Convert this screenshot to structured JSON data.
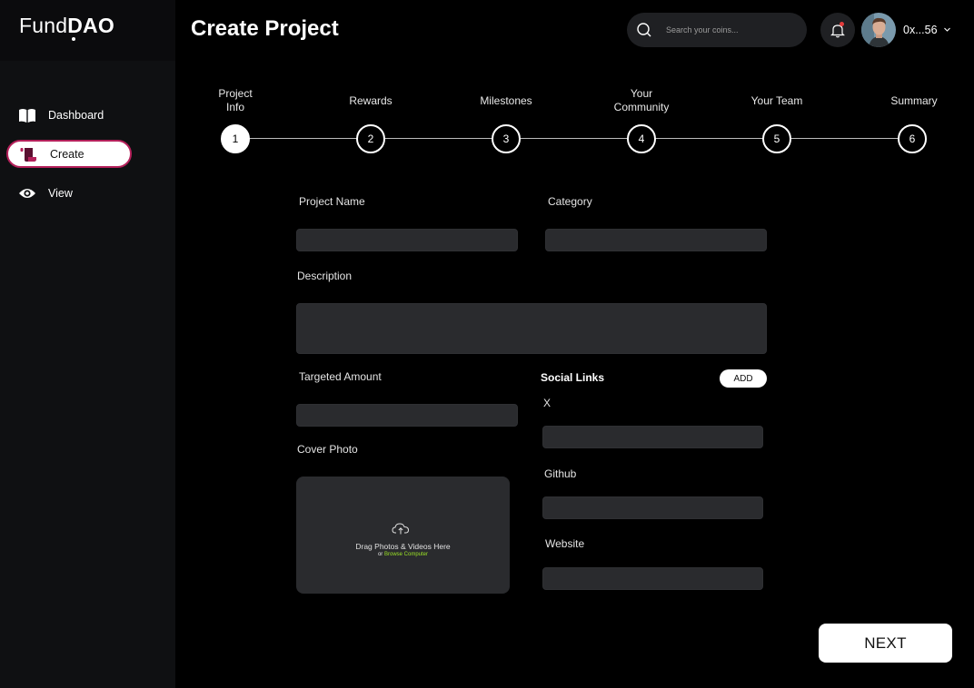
{
  "app": {
    "brand_light": "Fund",
    "brand_bold": "DAO",
    "accent_color": "#b4205a",
    "link_color": "#9be326"
  },
  "sidebar": {
    "items": [
      {
        "label": "Dashboard",
        "icon": "book-icon",
        "active": false
      },
      {
        "label": "Create",
        "icon": "scroll-icon",
        "active": true
      },
      {
        "label": "View",
        "icon": "eye-icon",
        "active": false
      }
    ]
  },
  "header": {
    "title": "Create Project",
    "search_placeholder": "Search your coins...",
    "account": "0x...56"
  },
  "stepper": {
    "current": 1,
    "steps": [
      {
        "number": "1",
        "label_lines": [
          "Project",
          "Info"
        ]
      },
      {
        "number": "2",
        "label_lines": [
          "Rewards"
        ]
      },
      {
        "number": "3",
        "label_lines": [
          "Milestones"
        ]
      },
      {
        "number": "4",
        "label_lines": [
          "Your",
          "Community"
        ]
      },
      {
        "number": "5",
        "label_lines": [
          "Your Team"
        ]
      },
      {
        "number": "6",
        "label_lines": [
          "Summary"
        ]
      }
    ]
  },
  "form": {
    "project_name_label": "Project Name",
    "project_name_value": "",
    "category_label": "Category",
    "category_value": "",
    "description_label": "Description",
    "description_value": "",
    "targeted_amount_label": "Targeted Amount",
    "targeted_amount_value": "",
    "cover_photo_label": "Cover Photo",
    "drop_main": "Drag Photos & Videos Here",
    "drop_or": "or ",
    "drop_link": "Browse Computer"
  },
  "social": {
    "title": "Social Links",
    "add_label": "ADD",
    "x_label": "X",
    "x_value": "",
    "github_label": "Github",
    "github_value": "",
    "website_label": "Website",
    "website_value": ""
  },
  "footer": {
    "next_label": "NEXT"
  }
}
